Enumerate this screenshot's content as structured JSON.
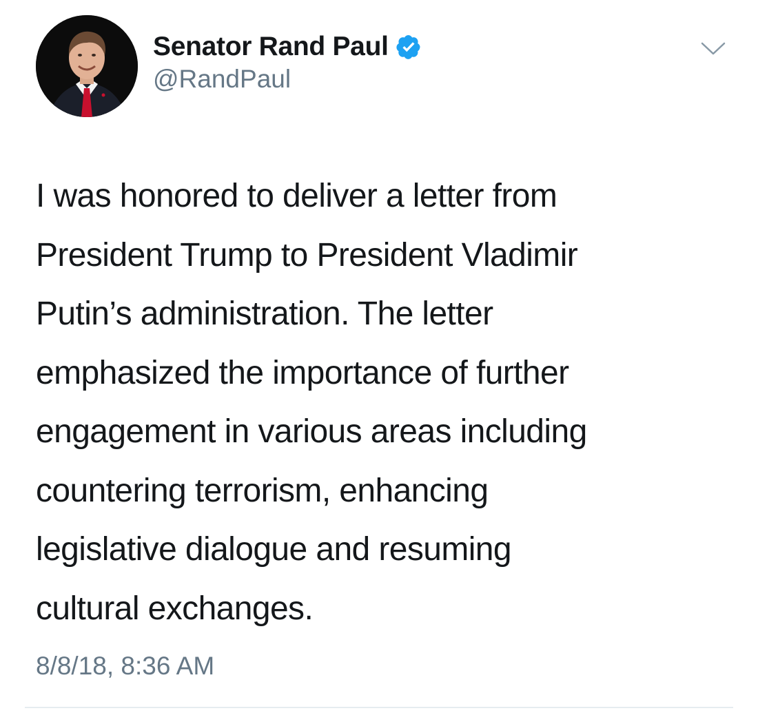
{
  "author": {
    "display_name": "Senator Rand Paul",
    "handle": "@RandPaul",
    "verified": true,
    "verified_icon": "verified-badge-icon",
    "verified_color": "#1da1f2"
  },
  "menu": {
    "icon": "chevron-down-icon"
  },
  "tweet": {
    "lines": [
      "I was honored to deliver a letter from",
      "President Trump to President Vladimir",
      "Putin’s administration. The letter",
      "emphasized the importance of further",
      "engagement in various areas including",
      "countering terrorism, enhancing",
      "legislative dialogue and resuming",
      "cultural exchanges."
    ],
    "timestamp": "8/8/18, 8:36 AM"
  },
  "colors": {
    "text": "#14171a",
    "secondary": "#657786",
    "divider": "#e6ecf0"
  }
}
